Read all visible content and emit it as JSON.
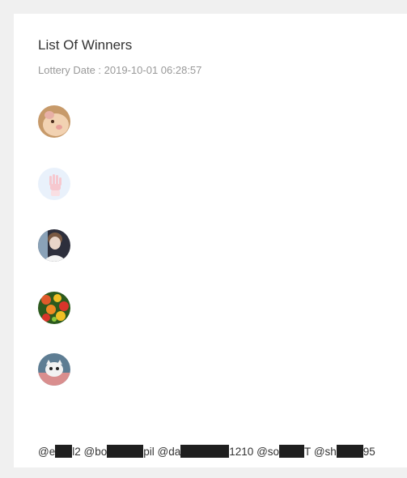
{
  "header": {
    "title": "List Of Winners",
    "date_label": "Lottery Date :",
    "date_value": "2019-10-01 06:28:57"
  },
  "avatars": [
    {
      "icon": "hamster-photo-icon",
      "colors": [
        "#c79a6a",
        "#f2d2b2",
        "#e8b0a6"
      ]
    },
    {
      "icon": "hand-photo-icon",
      "colors": [
        "#e9f1fb",
        "#f6c8cf",
        "#f9dfe3"
      ]
    },
    {
      "icon": "person-photo-icon",
      "colors": [
        "#2d2f3c",
        "#e8d5c9",
        "#f3f3f3"
      ]
    },
    {
      "icon": "fruit-photo-icon",
      "colors": [
        "#2c5a1e",
        "#e05a2b",
        "#f0c024"
      ]
    },
    {
      "icon": "cat-photo-icon",
      "colors": [
        "#5e7d93",
        "#d98e8e",
        "#f2f2f2"
      ]
    }
  ],
  "winners": [
    {
      "prefix": "@e",
      "suffix": "l2"
    },
    {
      "prefix": "@bo",
      "suffix": "pil"
    },
    {
      "prefix": "@da",
      "suffix": "1210"
    },
    {
      "prefix": "@so",
      "suffix": "T"
    },
    {
      "prefix": "@sh",
      "suffix": "95"
    }
  ]
}
